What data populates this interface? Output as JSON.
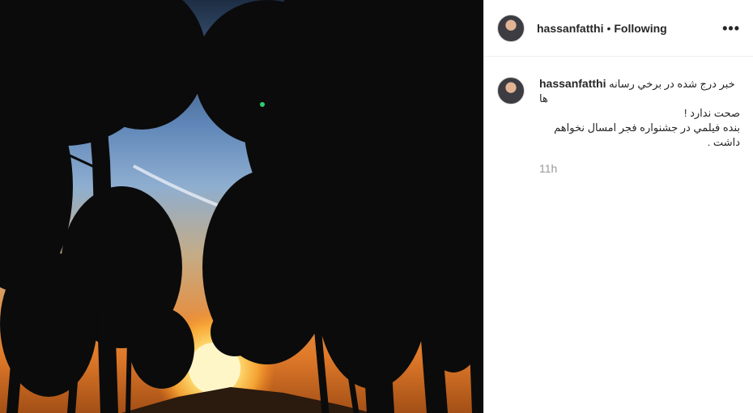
{
  "post": {
    "author": "hassanfatthi",
    "separator": "•",
    "follow_status": "Following",
    "more_options": "•••",
    "caption": {
      "username": "hassanfatthi",
      "line1": "خبر درج شده در برخي رسانه ها",
      "line2": "صحت ندارد !",
      "line3": "بنده فيلمي در جشنواره فجر امسال نخواهم داشت ."
    },
    "time_ago": "11h"
  },
  "colors": {
    "sky_top": "#1d2e44",
    "sky_blue": "#5f86b8",
    "sunset": "#e07a2a",
    "sun": "#fff2b0",
    "tree": "#0b0b0b",
    "text": "#262626",
    "muted": "#999999"
  },
  "icons": {
    "avatar": "profile-photo",
    "more": "ellipsis-icon"
  }
}
